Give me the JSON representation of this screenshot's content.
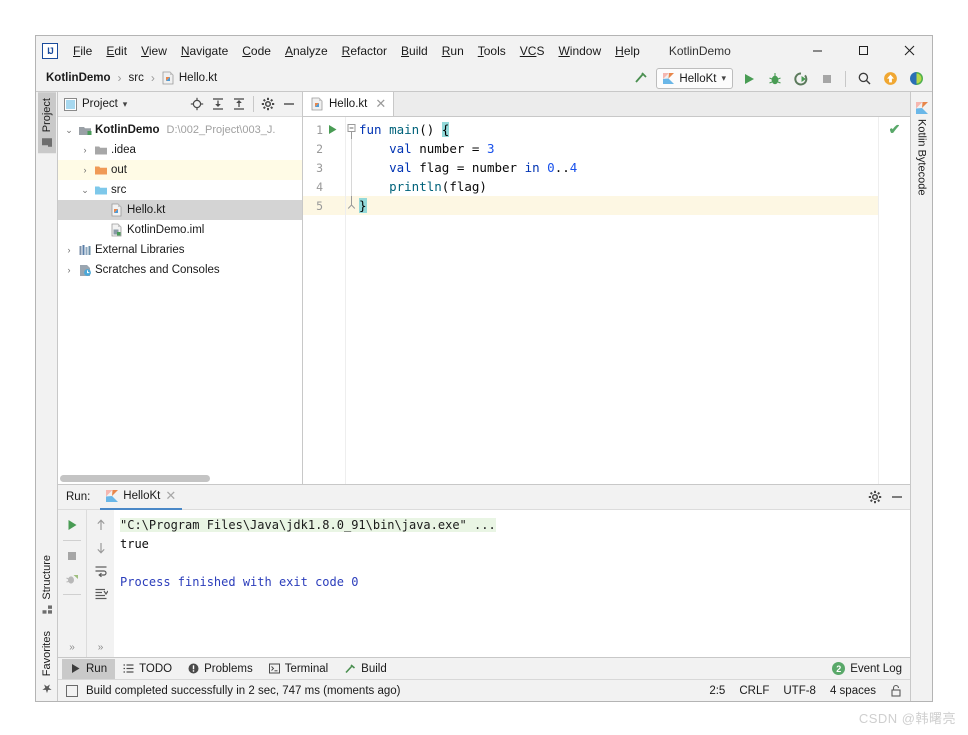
{
  "window": {
    "title": "KotlinDemo",
    "minimize_label": "─",
    "maximize_label": "☐",
    "close_label": "✕",
    "logo_text": "IJ"
  },
  "menubar": {
    "items": [
      {
        "label": "File",
        "mnemonic": "F",
        "rest": "ile"
      },
      {
        "label": "Edit",
        "mnemonic": "E",
        "rest": "dit"
      },
      {
        "label": "View",
        "mnemonic": "V",
        "rest": "iew"
      },
      {
        "label": "Navigate",
        "mnemonic": "N",
        "rest": "avigate"
      },
      {
        "label": "Code",
        "mnemonic": "C",
        "rest": "ode"
      },
      {
        "label": "Analyze",
        "mnemonic": "A",
        "rest": "nalyze"
      },
      {
        "label": "Refactor",
        "mnemonic": "R",
        "rest": "efactor"
      },
      {
        "label": "Build",
        "mnemonic": "B",
        "rest": "uild"
      },
      {
        "label": "Run",
        "mnemonic": "R",
        "rest": "un"
      },
      {
        "label": "Tools",
        "mnemonic": "T",
        "rest": "ools"
      },
      {
        "label": "VCS",
        "mnemonic": "VC",
        "rest": "S"
      },
      {
        "label": "Window",
        "mnemonic": "W",
        "rest": "indow"
      },
      {
        "label": "Help",
        "mnemonic": "H",
        "rest": "elp"
      }
    ]
  },
  "navbar": {
    "breadcrumbs": [
      {
        "label": "KotlinDemo",
        "icon": ""
      },
      {
        "label": "src",
        "icon": ""
      },
      {
        "label": "Hello.kt",
        "icon": "kotlin-file-icon"
      }
    ],
    "separator": "›",
    "run_config": "HelloKt",
    "run_config_caret": "▾",
    "buttons": [
      {
        "name": "build-hammer-icon",
        "title": "Build"
      },
      {
        "name": "run-button",
        "title": "Run"
      },
      {
        "name": "debug-button",
        "title": "Debug"
      },
      {
        "name": "run-with-coverage-button",
        "title": "Run with Coverage"
      },
      {
        "name": "stop-button",
        "title": "Stop"
      },
      {
        "name": "search-everywhere-icon",
        "title": "Search Everywhere"
      },
      {
        "name": "update-project-icon",
        "title": "Update Project"
      },
      {
        "name": "ide-feature-icon",
        "title": "IDE"
      }
    ]
  },
  "left_strip": {
    "tabs": [
      {
        "label": "Project",
        "selected": true,
        "icon": "project-icon"
      },
      {
        "label": "Structure",
        "selected": false,
        "icon": "structure-icon"
      },
      {
        "label": "Favorites",
        "selected": false,
        "icon": "star-icon"
      }
    ]
  },
  "right_strip": {
    "tabs": [
      {
        "label": "Kotlin Bytecode",
        "selected": false,
        "icon": "kotlin-icon"
      }
    ]
  },
  "project_panel": {
    "title": "Project",
    "title_caret": "▾",
    "toolbar": [
      {
        "name": "locate-file-icon",
        "title": "Select Opened File"
      },
      {
        "name": "expand-all-icon",
        "title": "Expand All"
      },
      {
        "name": "collapse-all-icon",
        "title": "Collapse All"
      },
      {
        "name": "settings-gear-icon",
        "title": "Settings"
      },
      {
        "name": "hide-panel-icon",
        "title": "Hide"
      }
    ],
    "tree": [
      {
        "label": "KotlinDemo",
        "path": "D:\\002_Project\\003_J.",
        "indent": 0,
        "arrow": "⌄",
        "icon": "module-icon",
        "bold": true,
        "selected": false,
        "highlight": false
      },
      {
        "label": ".idea",
        "path": "",
        "indent": 1,
        "arrow": "›",
        "icon": "folder-icon",
        "bold": false,
        "selected": false,
        "highlight": false
      },
      {
        "label": "out",
        "path": "",
        "indent": 1,
        "arrow": "›",
        "icon": "folder-orange-icon",
        "bold": false,
        "selected": false,
        "highlight": true
      },
      {
        "label": "src",
        "path": "",
        "indent": 1,
        "arrow": "⌄",
        "icon": "folder-source-icon",
        "bold": false,
        "selected": false,
        "highlight": false
      },
      {
        "label": "Hello.kt",
        "path": "",
        "indent": 2,
        "arrow": "",
        "icon": "kotlin-file-icon",
        "bold": false,
        "selected": true,
        "highlight": false
      },
      {
        "label": "KotlinDemo.iml",
        "path": "",
        "indent": 2,
        "arrow": "",
        "icon": "iml-file-icon",
        "bold": false,
        "selected": false,
        "highlight": false
      },
      {
        "label": "External Libraries",
        "path": "",
        "indent": 0,
        "arrow": "›",
        "icon": "libraries-icon",
        "bold": false,
        "selected": false,
        "highlight": false
      },
      {
        "label": "Scratches and Consoles",
        "path": "",
        "indent": 0,
        "arrow": "›",
        "icon": "scratches-icon",
        "bold": false,
        "selected": false,
        "highlight": false
      }
    ]
  },
  "editor": {
    "tabs": [
      {
        "label": "Hello.kt",
        "icon": "kotlin-file-icon",
        "close": "✕",
        "active": true
      }
    ],
    "line_numbers": [
      "1",
      "2",
      "3",
      "4",
      "5"
    ],
    "current_line": 5,
    "inspection_status": "✔",
    "lines": [
      {
        "n": 1,
        "tokens": [
          {
            "t": "fun ",
            "c": "kw"
          },
          {
            "t": "main",
            "c": "fnname"
          },
          {
            "t": "() ",
            "c": "plain"
          },
          {
            "t": "{",
            "c": "brace-hl"
          }
        ]
      },
      {
        "n": 2,
        "tokens": [
          {
            "t": "    ",
            "c": "plain"
          },
          {
            "t": "val ",
            "c": "kw"
          },
          {
            "t": "number = ",
            "c": "plain"
          },
          {
            "t": "3",
            "c": "num"
          }
        ]
      },
      {
        "n": 3,
        "tokens": [
          {
            "t": "    ",
            "c": "plain"
          },
          {
            "t": "val ",
            "c": "kw"
          },
          {
            "t": "flag = number ",
            "c": "plain"
          },
          {
            "t": "in ",
            "c": "kw"
          },
          {
            "t": "0",
            "c": "num"
          },
          {
            "t": "..",
            "c": "plain"
          },
          {
            "t": "4",
            "c": "num"
          }
        ]
      },
      {
        "n": 4,
        "tokens": [
          {
            "t": "    ",
            "c": "plain"
          },
          {
            "t": "println",
            "c": "fnname"
          },
          {
            "t": "(flag)",
            "c": "plain"
          }
        ]
      },
      {
        "n": 5,
        "tokens": [
          {
            "t": "}",
            "c": "brace-hl"
          }
        ]
      }
    ]
  },
  "run_panel": {
    "label": "Run:",
    "tab": {
      "label": "HelloKt",
      "icon": "kotlin-icon",
      "close": "✕"
    },
    "header_buttons": [
      {
        "name": "settings-gear-icon",
        "title": "Settings"
      },
      {
        "name": "hide-panel-icon",
        "title": "Hide"
      }
    ],
    "toolbar_left": [
      {
        "name": "rerun-button",
        "title": "Rerun"
      },
      {
        "name": "stop-button",
        "title": "Stop"
      },
      {
        "name": "dump-threads-button",
        "title": "Dump Threads"
      }
    ],
    "toolbar_right": [
      {
        "name": "prev-occurrence-button",
        "title": "Up"
      },
      {
        "name": "next-occurrence-button",
        "title": "Down"
      },
      {
        "name": "soft-wrap-button",
        "title": "Soft-Wrap"
      },
      {
        "name": "scroll-to-end-button",
        "title": "Scroll to End"
      }
    ],
    "chevrons": "»",
    "console": [
      {
        "text": "\"C:\\Program Files\\Java\\jdk1.8.0_91\\bin\\java.exe\" ...",
        "style": "cmd"
      },
      {
        "text": "true",
        "style": "out"
      },
      {
        "text": "",
        "style": "out"
      },
      {
        "text": "Process finished with exit code 0",
        "style": "fin"
      }
    ]
  },
  "bottom_bar": {
    "items": [
      {
        "label": "Run",
        "icon": "run-icon",
        "selected": true
      },
      {
        "label": "TODO",
        "icon": "todo-icon",
        "selected": false
      },
      {
        "label": "Problems",
        "icon": "problems-icon",
        "selected": false
      },
      {
        "label": "Terminal",
        "icon": "terminal-icon",
        "selected": false
      },
      {
        "label": "Build",
        "icon": "build-hammer-icon",
        "selected": false
      }
    ],
    "event_log": {
      "label": "Event Log",
      "count": "2"
    }
  },
  "status_bar": {
    "message": "Build completed successfully in 2 sec, 747 ms (moments ago)",
    "caret_position": "2:5",
    "line_separator": "CRLF",
    "encoding": "UTF-8",
    "indent": "4 spaces",
    "lock_icon": "lock-icon"
  },
  "watermark": "CSDN @韩曙亮",
  "colors": {
    "accent_blue": "#4a88c7",
    "keyword": "#0033b3",
    "number": "#1750eb",
    "function": "#00627a",
    "console_finish": "#2b3dbb",
    "green_ok": "#59a869",
    "highlight_row": "#fffbe6",
    "selected_row": "#d4d4d4",
    "current_line": "#fdf7e3"
  }
}
